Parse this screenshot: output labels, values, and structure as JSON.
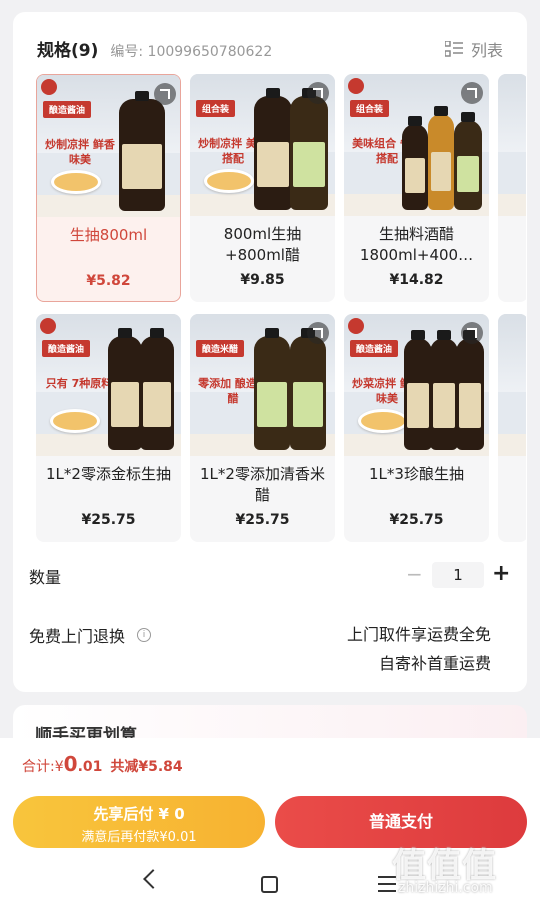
{
  "header": {
    "title": "规格(9)",
    "code_label": "编号: 10099650780622",
    "list_label": "列表"
  },
  "skus": [
    {
      "name": "生抽800ml",
      "price": "¥5.82",
      "tag": "酿造酱油",
      "slogan": "炒制凉拌 鲜香味美",
      "selected": true
    },
    {
      "name": "800ml生抽+800ml醋",
      "price": "¥9.85",
      "tag": "组合装",
      "slogan": "炒制凉拌 美味搭配",
      "selected": false
    },
    {
      "name": "生抽料酒醋1800ml+400…",
      "price": "¥14.82",
      "tag": "组合装",
      "slogan": "美味组合 省心搭配",
      "selected": false
    },
    {
      "name": "1L*2零添金标生抽",
      "price": "¥25.75",
      "tag": "酿造酱油",
      "slogan": "只有 7种原料",
      "selected": false
    },
    {
      "name": "1L*2零添加清香米醋",
      "price": "¥25.75",
      "tag": "酿造米醋",
      "slogan": "零添加 酿造米醋",
      "selected": false
    },
    {
      "name": "1L*3珍酿生抽",
      "price": "¥25.75",
      "tag": "酿造酱油",
      "slogan": "炒菜凉拌 鲜香味美",
      "selected": false
    }
  ],
  "quantity": {
    "label": "数量",
    "value": "1",
    "minus": "−",
    "plus": "+"
  },
  "return": {
    "label": "免费上门退换",
    "info_icon": "i",
    "line1": "上门取件享运费全免",
    "line2": "自寄补首重运费"
  },
  "next_section": {
    "title": "顺手买更划算"
  },
  "footer": {
    "total_label": "合计: ",
    "total_currency": "¥",
    "total_int": "0",
    "total_dec": ".01",
    "save": "共减¥5.84",
    "btn_later_title": "先享后付 ¥ 0",
    "btn_later_sub": "满意后再付款¥0.01",
    "btn_pay": "普通支付"
  },
  "watermark": {
    "text": "值值值",
    "sub": "zhizhizhi.com"
  },
  "colors": {
    "accent": "#d0473b",
    "pay_btn": "#e34644",
    "later_btn": "#f8c03a"
  }
}
